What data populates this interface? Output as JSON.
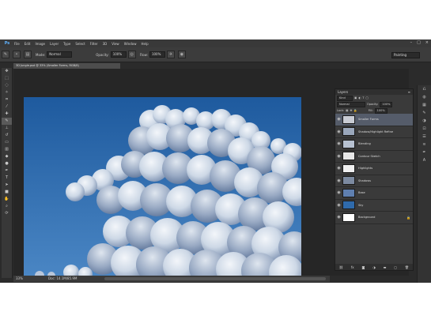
{
  "app": {
    "logo": "Ps",
    "menu": [
      "File",
      "Edit",
      "Image",
      "Layer",
      "Type",
      "Select",
      "Filter",
      "3D",
      "View",
      "Window",
      "Help"
    ],
    "window_controls": [
      "–",
      "□",
      "×"
    ]
  },
  "options": {
    "mode_label": "Mode:",
    "mode_value": "Normal",
    "opacity_label": "Opacity:",
    "opacity_value": "100%",
    "flow_label": "Flow:",
    "flow_value": "100%",
    "workspace": "Painting"
  },
  "document": {
    "tab_title": "3D Jungle.psd @ 33% (Smaller Forms, RGB/8)",
    "zoom": "33%",
    "doc_size": "Doc: 14.1M/85.9M"
  },
  "layers_panel": {
    "title": "Layers",
    "filter_label": "Kind",
    "blend_mode": "Normal",
    "opacity_label": "Opacity:",
    "opacity_value": "100%",
    "lock_label": "Lock:",
    "fill_label": "Fill:",
    "fill_value": "100%",
    "layers": [
      {
        "name": "Smaller Forms",
        "selected": true,
        "thumb": "#c9ccd4"
      },
      {
        "name": "Shadow/Highlight Refine",
        "selected": false,
        "thumb": "#9aa7bb"
      },
      {
        "name": "Blending",
        "selected": false,
        "thumb": "#b7c1d1"
      },
      {
        "name": "Contour Sketch",
        "selected": false,
        "thumb": "#e7e7e7"
      },
      {
        "name": "Highlights",
        "selected": false,
        "thumb": "#f0f0f0"
      },
      {
        "name": "Shadows",
        "selected": false,
        "thumb": "#7c8aa0"
      },
      {
        "name": "Base",
        "selected": false,
        "thumb": "#5f7fb0"
      },
      {
        "name": "Sky",
        "selected": false,
        "thumb": "#2f6aab"
      },
      {
        "name": "Background",
        "selected": false,
        "thumb": "#ffffff",
        "locked": true
      }
    ]
  },
  "colors": {
    "sky_top": "#1f5a9d",
    "sky_bottom": "#3f7cbb",
    "cloud_light": "#e8eef5",
    "cloud_shadow": "#7f93b2"
  }
}
